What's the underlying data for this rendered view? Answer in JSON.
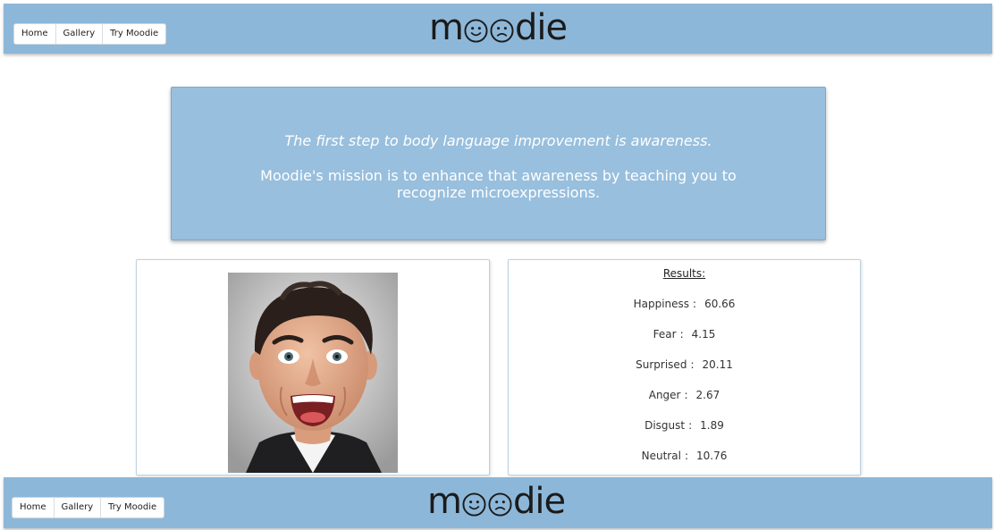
{
  "nav": {
    "items": [
      "Home",
      "Gallery",
      "Try Moodie"
    ]
  },
  "logo": {
    "prefix": "m",
    "suffix": "die",
    "faces": [
      "smiling-face-icon",
      "frowning-face-icon"
    ]
  },
  "mission": {
    "lead": "The first step to body language improvement is awareness.",
    "body": "Moodie's mission is to enhance that awareness by teaching you to recognize microexpressions."
  },
  "results": {
    "title": "Results:",
    "emotions": [
      {
        "label": "Happiness",
        "value": "60.66"
      },
      {
        "label": "Fear",
        "value": "4.15"
      },
      {
        "label": "Surprised",
        "value": "20.11"
      },
      {
        "label": "Anger",
        "value": "2.67"
      },
      {
        "label": "Disgust",
        "value": "1.89"
      },
      {
        "label": "Neutral",
        "value": "10.76"
      }
    ]
  },
  "colors": {
    "navbar": "#8db7d8",
    "mission_bg": "#98bfdd",
    "card_border": "#bcd2e3"
  }
}
